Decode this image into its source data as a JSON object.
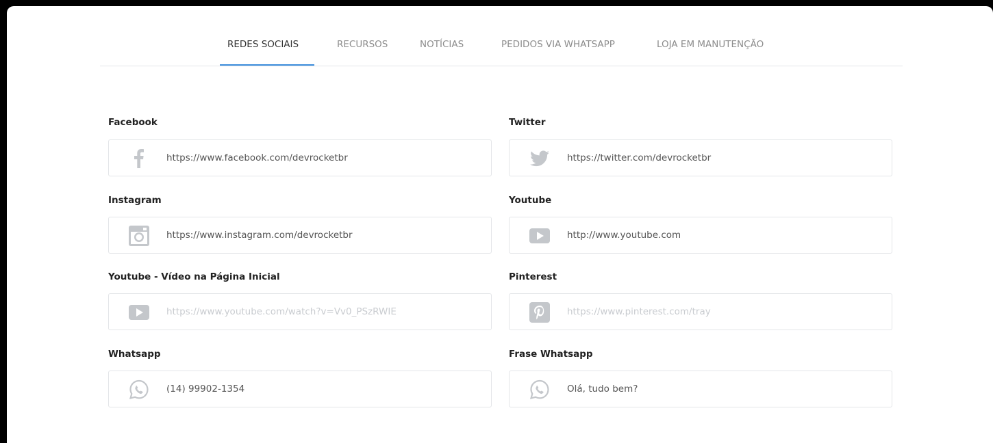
{
  "tabs": [
    {
      "label": "REDES SOCIAIS",
      "active": true
    },
    {
      "label": "RECURSOS"
    },
    {
      "label": "NOTÍCIAS"
    },
    {
      "label": "PEDIDOS VIA WHATSAPP"
    },
    {
      "label": "LOJA EM MANUTENÇÃO"
    }
  ],
  "fields": {
    "facebook": {
      "label": "Facebook",
      "value": "https://www.facebook.com/devrocketbr",
      "placeholder": "",
      "icon": "facebook-icon"
    },
    "twitter": {
      "label": "Twitter",
      "value": "https://twitter.com/devrocketbr",
      "placeholder": "",
      "icon": "twitter-icon"
    },
    "instagram": {
      "label": "Instagram",
      "value": "https://www.instagram.com/devrocketbr",
      "placeholder": "",
      "icon": "instagram-icon"
    },
    "youtube": {
      "label": "Youtube",
      "value": "http://www.youtube.com",
      "placeholder": "",
      "icon": "youtube-icon"
    },
    "youtube_video": {
      "label": "Youtube - Vídeo na Página Inicial",
      "value": "",
      "placeholder": "https://www.youtube.com/watch?v=Vv0_PSzRWIE",
      "icon": "youtube-icon"
    },
    "pinterest": {
      "label": "Pinterest",
      "value": "",
      "placeholder": "https://www.pinterest.com/tray",
      "icon": "pinterest-icon"
    },
    "whatsapp": {
      "label": "Whatsapp",
      "value": "(14) 99902-1354",
      "placeholder": "",
      "icon": "whatsapp-icon"
    },
    "whatsapp_phrase": {
      "label": "Frase Whatsapp",
      "value": "Olá, tudo bem?",
      "placeholder": "",
      "icon": "whatsapp-icon"
    }
  },
  "colors": {
    "accent": "#3c8ddc",
    "icon_gray": "#c4c7cb"
  }
}
